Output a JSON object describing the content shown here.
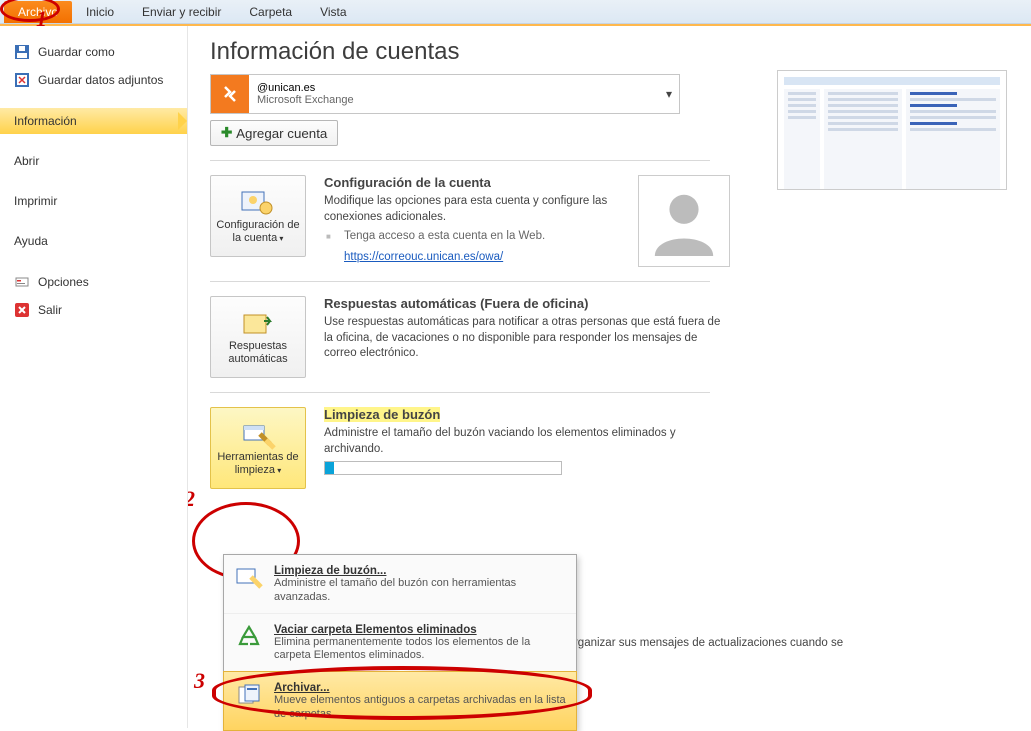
{
  "ribbon": {
    "tabs": [
      "Archivo",
      "Inicio",
      "Enviar y recibir",
      "Carpeta",
      "Vista"
    ]
  },
  "nav": {
    "save_as": "Guardar como",
    "save_att": "Guardar datos adjuntos",
    "info": "Información",
    "open": "Abrir",
    "print": "Imprimir",
    "help": "Ayuda",
    "options": "Opciones",
    "exit": "Salir"
  },
  "title": "Información de cuentas",
  "account": {
    "email": "@unican.es",
    "type": "Microsoft Exchange",
    "add": "Agregar cuenta"
  },
  "sections": {
    "config": {
      "btn": "Configuración de la cuenta",
      "h": "Configuración de la cuenta",
      "p": "Modifique las opciones para esta cuenta y configure las conexiones adicionales.",
      "sub": "Tenga acceso a esta cuenta en la Web.",
      "link": "https://correouc.unican.es/owa/"
    },
    "auto": {
      "btn": "Respuestas automáticas",
      "h": "Respuestas automáticas (Fuera de oficina)",
      "p": "Use respuestas automáticas para notificar a otras personas que está fuera de la oficina, de vacaciones o no disponible para responder los mensajes de correo electrónico."
    },
    "clean": {
      "btn": "Herramientas de limpieza",
      "h": "Limpieza de buzón",
      "p": "Administre el tamaño del buzón vaciando los elementos eliminados y archivando."
    },
    "rules": {
      "p": "en a organizar sus mensajes de actualizaciones cuando se"
    }
  },
  "popup": {
    "i1": {
      "t": "Limpieza de buzón...",
      "d": "Administre el tamaño del buzón con herramientas avanzadas."
    },
    "i2": {
      "t": "Vaciar carpeta Elementos eliminados",
      "d": "Elimina permanentemente todos los elementos de la carpeta Elementos eliminados."
    },
    "i3": {
      "t": "Archivar...",
      "d": "Mueve elementos antiguos a carpetas archivadas en la lista de carpetas."
    }
  },
  "ann": {
    "n1": "1",
    "n2": "2",
    "n3": "3"
  }
}
